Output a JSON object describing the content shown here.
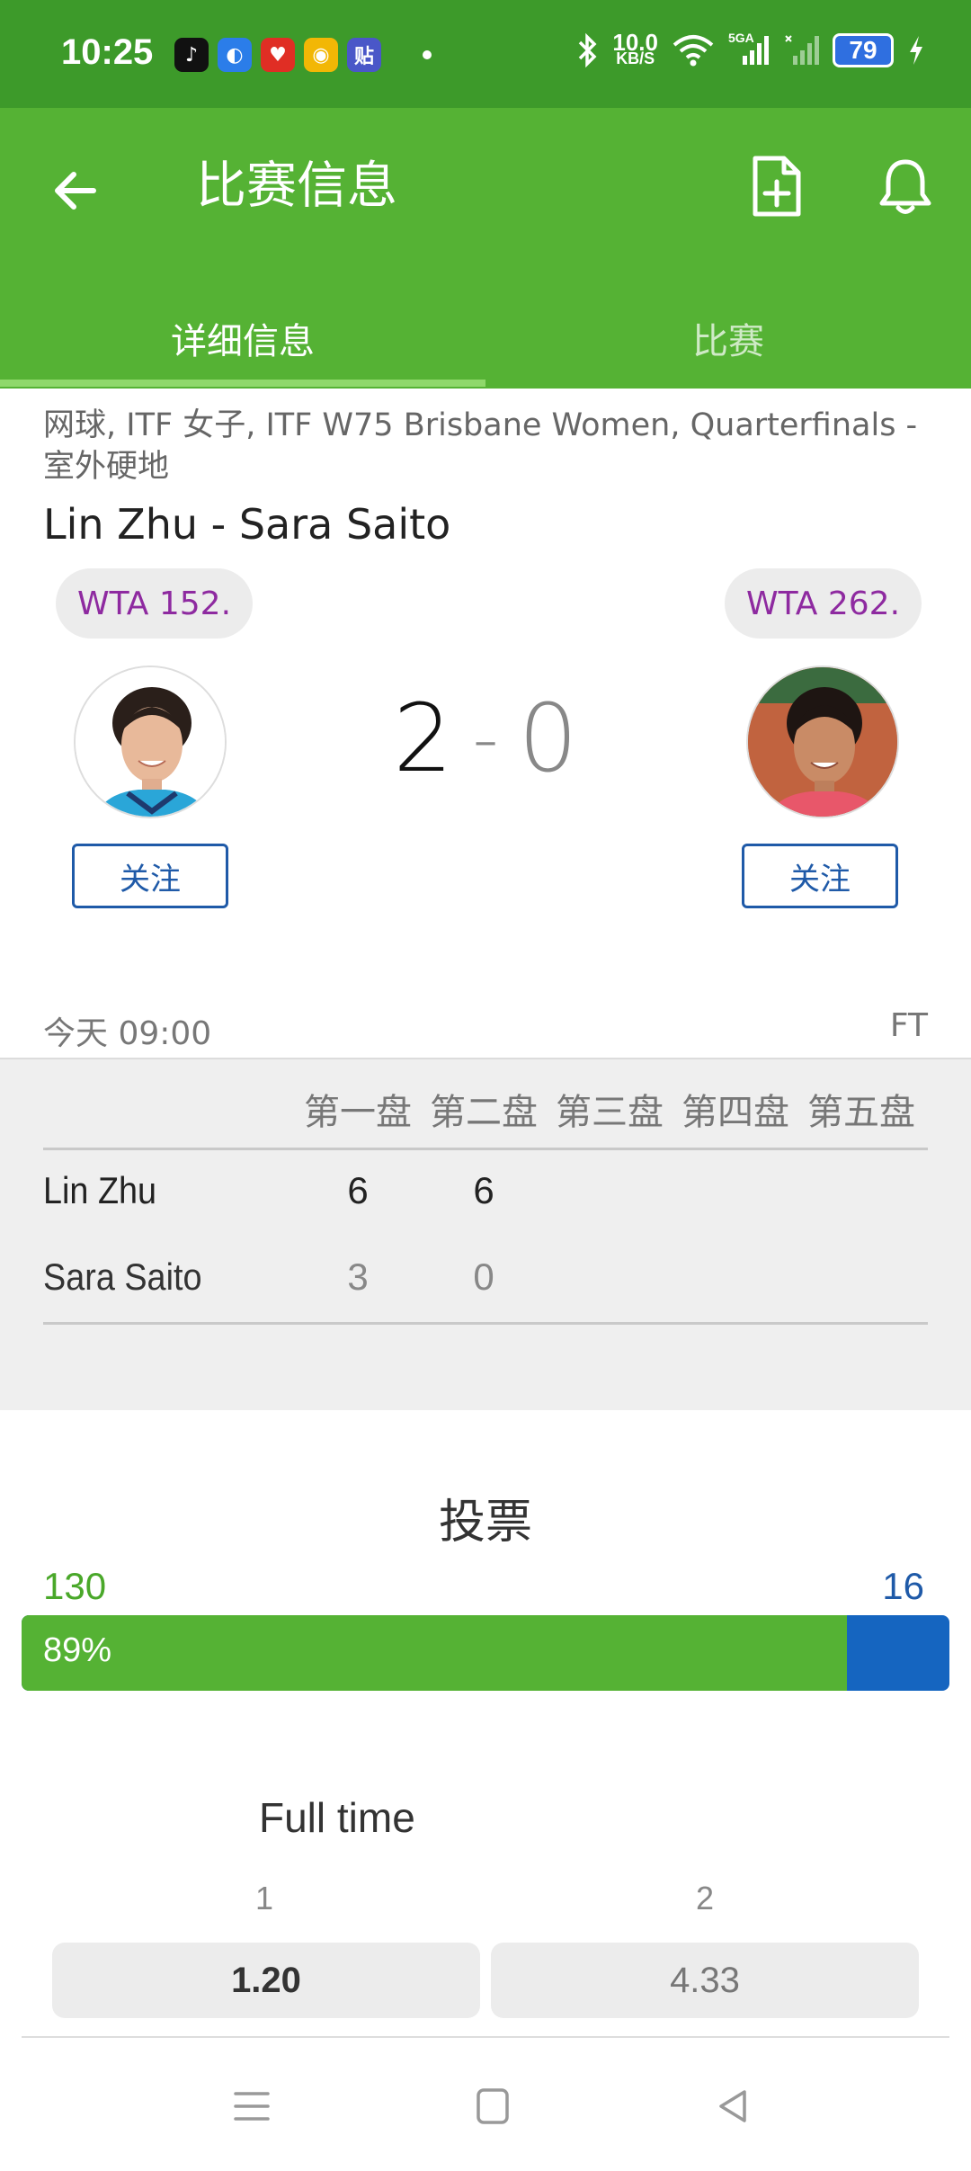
{
  "status_bar": {
    "time": "10:25",
    "net_speed_value": "10.0",
    "net_speed_unit": "KB/S",
    "signal_label": "5GA",
    "battery": "79",
    "apps": [
      "tiktok-icon",
      "browser-icon",
      "pinduoduo-icon",
      "weibo-icon",
      "tieba-icon"
    ]
  },
  "app_bar": {
    "title": "比赛信息",
    "tabs": [
      {
        "label": "详细信息",
        "active": true
      },
      {
        "label": "比赛",
        "active": false
      }
    ]
  },
  "match": {
    "tournament": "网球, ITF 女子, ITF W75 Brisbane Women, Quarterfinals - 室外硬地",
    "title": "Lin Zhu - Sara Saito",
    "home": {
      "name": "Lin Zhu",
      "ranking": "WTA 152.",
      "follow_label": "关注"
    },
    "away": {
      "name": "Sara Saito",
      "ranking": "WTA 262.",
      "follow_label": "关注"
    },
    "score_home": "2",
    "score_separator": "-",
    "score_away": "0",
    "start_time": "今天 09:00",
    "status": "FT"
  },
  "sets": {
    "headers": [
      "第一盘",
      "第二盘",
      "第三盘",
      "第四盘",
      "第五盘"
    ],
    "rows": [
      {
        "player": "Lin Zhu",
        "scores": [
          "6",
          "6"
        ]
      },
      {
        "player": "Sara Saito",
        "scores": [
          "3",
          "0"
        ]
      }
    ]
  },
  "votes": {
    "title": "投票",
    "home_count": "130",
    "away_count": "16",
    "home_percent_label": "89%",
    "home_fraction": 0.89
  },
  "odds": {
    "title": "Full time",
    "labels": [
      "1",
      "2"
    ],
    "values": [
      "1.20",
      "4.33"
    ]
  },
  "colors": {
    "status_bar": "#3d9a2a",
    "app_bar": "#55b234",
    "home_accent": "#55b234",
    "away_accent": "#1565c0",
    "rank_text": "#8e2aa0"
  }
}
